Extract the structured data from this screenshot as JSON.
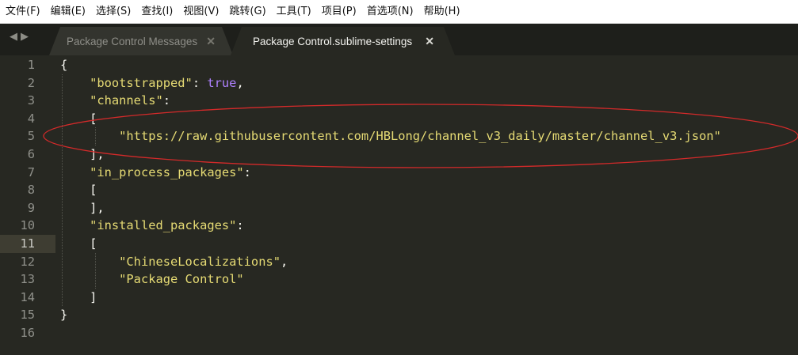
{
  "menu": [
    "文件(F)",
    "编辑(E)",
    "选择(S)",
    "查找(I)",
    "视图(V)",
    "跳转(G)",
    "工具(T)",
    "项目(P)",
    "首选项(N)",
    "帮助(H)"
  ],
  "nav": {
    "back_glyph": "◀",
    "forward_glyph": "▶"
  },
  "tabs": [
    {
      "title": "Package Control Messages",
      "active": false,
      "close_glyph": "✕"
    },
    {
      "title": "Package Control.sublime-settings",
      "active": true,
      "close_glyph": "✕"
    }
  ],
  "editor": {
    "current_line": 11,
    "line_numbers": [
      "1",
      "2",
      "3",
      "4",
      "5",
      "6",
      "7",
      "8",
      "9",
      "10",
      "11",
      "12",
      "13",
      "14",
      "15",
      "16"
    ],
    "lines": [
      [
        [
          "pun",
          "{"
        ]
      ],
      [
        [
          "pun",
          "    "
        ],
        [
          "str",
          "\"bootstrapped\""
        ],
        [
          "pun",
          ": "
        ],
        [
          "kw",
          "true"
        ],
        [
          "pun",
          ","
        ]
      ],
      [
        [
          "pun",
          "    "
        ],
        [
          "str",
          "\"channels\""
        ],
        [
          "pun",
          ":"
        ]
      ],
      [
        [
          "pun",
          "    ["
        ]
      ],
      [
        [
          "pun",
          "        "
        ],
        [
          "str",
          "\"https://raw.githubusercontent.com/HBLong/channel_v3_daily/master/channel_v3.json\""
        ]
      ],
      [
        [
          "pun",
          "    ],"
        ]
      ],
      [
        [
          "pun",
          "    "
        ],
        [
          "str",
          "\"in_process_packages\""
        ],
        [
          "pun",
          ":"
        ]
      ],
      [
        [
          "pun",
          "    ["
        ]
      ],
      [
        [
          "pun",
          "    ],"
        ]
      ],
      [
        [
          "pun",
          "    "
        ],
        [
          "str",
          "\"installed_packages\""
        ],
        [
          "pun",
          ":"
        ]
      ],
      [
        [
          "pun",
          "    ["
        ]
      ],
      [
        [
          "pun",
          "        "
        ],
        [
          "str",
          "\"ChineseLocalizations\""
        ],
        [
          "pun",
          ","
        ]
      ],
      [
        [
          "pun",
          "        "
        ],
        [
          "str",
          "\"Package Control\""
        ]
      ],
      [
        [
          "pun",
          "    ]"
        ]
      ],
      [
        [
          "pun",
          "}"
        ]
      ],
      []
    ]
  },
  "colors": {
    "background": "#272822",
    "string": "#e6db74",
    "keyword": "#ae81ff",
    "annotation_ellipse": "#d42a2a"
  }
}
